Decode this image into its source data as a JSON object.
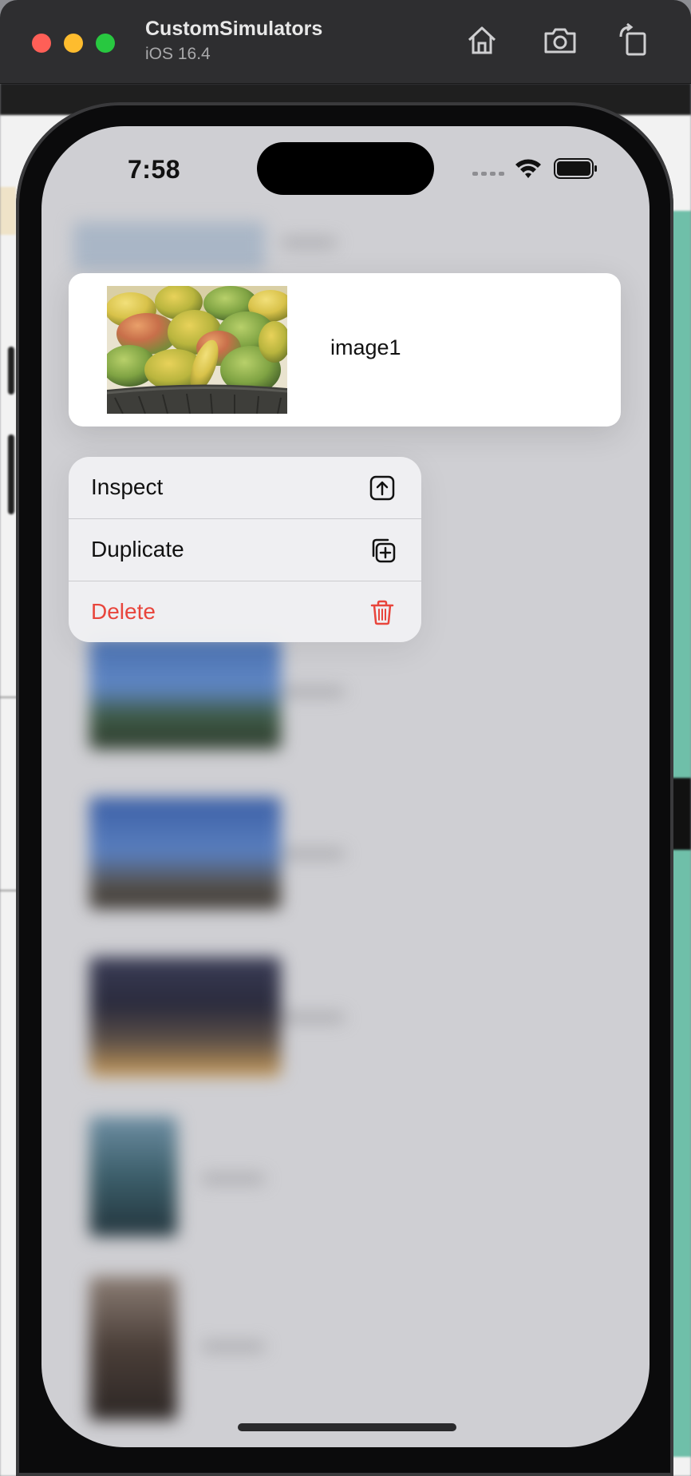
{
  "simulator": {
    "title": "CustomSimulators",
    "subtitle": "iOS 16.4",
    "toolbar_icons": [
      "home-icon",
      "screenshot-icon",
      "rotate-icon"
    ]
  },
  "status_bar": {
    "time": "7:58",
    "icons": [
      "signal-icon",
      "wifi-icon",
      "battery-icon"
    ]
  },
  "preview": {
    "label": "image1",
    "image": "mango-photo"
  },
  "context_menu": {
    "items": [
      {
        "label": "Inspect",
        "icon": "square-arrow-up-icon",
        "destructive": false
      },
      {
        "label": "Duplicate",
        "icon": "plus-square-on-square-icon",
        "destructive": false
      },
      {
        "label": "Delete",
        "icon": "trash-icon",
        "destructive": true
      }
    ],
    "destructive_color": "#e8453c"
  },
  "colors": {
    "accent_teal": "#6fbfa9",
    "dimmed_background": "#cfcfd3"
  }
}
